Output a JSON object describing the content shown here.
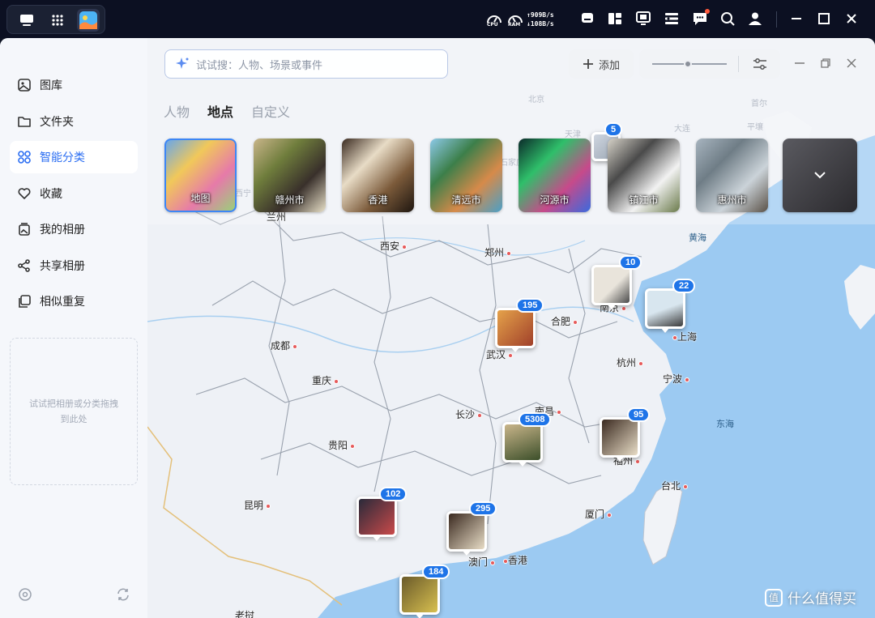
{
  "system_bar": {
    "cpu_label": "CPU",
    "ram_label": "RAM",
    "net_up": "↑909B/s",
    "net_down": "↓108B/s",
    "icons": [
      "monitor-icon",
      "apps-grid-icon",
      "photos-app-icon",
      "tray-icon",
      "widgets-icon",
      "remote-icon",
      "panel-icon",
      "chat-icon",
      "search-icon",
      "user-icon",
      "minimize-icon",
      "maximize-icon",
      "close-icon"
    ]
  },
  "sidebar": {
    "items": [
      {
        "label": "图库",
        "icon": "gallery-icon"
      },
      {
        "label": "文件夹",
        "icon": "folder-icon"
      },
      {
        "label": "智能分类",
        "icon": "smart-category-icon",
        "active": true
      },
      {
        "label": "收藏",
        "icon": "heart-icon"
      },
      {
        "label": "我的相册",
        "icon": "album-icon"
      },
      {
        "label": "共享相册",
        "icon": "share-icon"
      },
      {
        "label": "相似重复",
        "icon": "duplicate-icon"
      }
    ],
    "dropzone_text": "试试把相册或分类拖拽到此处",
    "footer_icons": [
      "settings-icon",
      "sync-icon"
    ]
  },
  "toolbar": {
    "search_placeholder": "试试搜：人物、场景或事件",
    "add_label": "添加",
    "zoom_value": 0.48
  },
  "tabs": [
    {
      "label": "人物"
    },
    {
      "label": "地点",
      "active": true
    },
    {
      "label": "自定义"
    }
  ],
  "place_cards": [
    {
      "label": "地图",
      "active": true,
      "colors": [
        "#6aa7e8",
        "#f1c85a",
        "#e67aa9",
        "#9ad07a"
      ]
    },
    {
      "label": "赣州市",
      "colors": [
        "#c9b58a",
        "#6f7d3c",
        "#39302b",
        "#e8e0c8"
      ]
    },
    {
      "label": "香港",
      "colors": [
        "#3a2a20",
        "#e8dcc6",
        "#7b5a3a",
        "#1e1610"
      ]
    },
    {
      "label": "清远市",
      "colors": [
        "#8cc9e8",
        "#3c7f4a",
        "#d68a4a",
        "#4aa0c8"
      ]
    },
    {
      "label": "河源市",
      "colors": [
        "#0b2a2a",
        "#2fbf6a",
        "#c74a8a",
        "#3a6adf"
      ]
    },
    {
      "label": "镇江市",
      "colors": [
        "#d6d2c8",
        "#4a4a4a",
        "#f2f2f2",
        "#6a7a4a"
      ]
    },
    {
      "label": "惠州市",
      "colors": [
        "#a7b4bf",
        "#6f7d86",
        "#cbd3d9",
        "#5a5147"
      ]
    }
  ],
  "map_cities": [
    {
      "name": "西安"
    },
    {
      "name": "郑州"
    },
    {
      "name": "合肥"
    },
    {
      "name": "南京"
    },
    {
      "name": "上海"
    },
    {
      "name": "武汉"
    },
    {
      "name": "杭州"
    },
    {
      "name": "宁波"
    },
    {
      "name": "成都"
    },
    {
      "name": "重庆"
    },
    {
      "name": "长沙"
    },
    {
      "name": "南昌"
    },
    {
      "name": "贵阳"
    },
    {
      "name": "福州"
    },
    {
      "name": "台北"
    },
    {
      "name": "昆明"
    },
    {
      "name": "厦门"
    },
    {
      "name": "澳门"
    },
    {
      "name": "香港"
    },
    {
      "name": "兰州"
    },
    {
      "name": "北京"
    },
    {
      "name": "天津"
    },
    {
      "name": "大连"
    },
    {
      "name": "平壤"
    },
    {
      "name": "首尔"
    },
    {
      "name": "石家庄"
    },
    {
      "name": "西宁"
    },
    {
      "name": "老挝"
    }
  ],
  "map_seas": [
    {
      "name": "黄海"
    },
    {
      "name": "东海"
    }
  ],
  "clusters": [
    {
      "count": "5",
      "colors": [
        "#cfd6e0",
        "#9aa5b2"
      ]
    },
    {
      "count": "10",
      "colors": [
        "#e9e4db",
        "#4a4a4a"
      ]
    },
    {
      "count": "22",
      "colors": [
        "#d8e6ef",
        "#3a3a3a"
      ]
    },
    {
      "count": "195",
      "colors": [
        "#a0402a",
        "#e5a24a"
      ]
    },
    {
      "count": "5308",
      "colors": [
        "#c9b58a",
        "#3c4f2a"
      ]
    },
    {
      "count": "95",
      "colors": [
        "#3a2a20",
        "#e8dcc6"
      ]
    },
    {
      "count": "102",
      "colors": [
        "#2a2a3a",
        "#c94a4a"
      ]
    },
    {
      "count": "295",
      "colors": [
        "#3a2a20",
        "#e8dcc6"
      ]
    },
    {
      "count": "184",
      "colors": [
        "#6a5a2a",
        "#d8c050"
      ]
    }
  ],
  "watermark": {
    "text": "什么值得买",
    "icon_glyph": "值"
  },
  "colors": {
    "accent": "#1e74e8",
    "active_nav": "#2b6ef2",
    "sea": "#9ccaf2",
    "land": "#eef1f6"
  }
}
